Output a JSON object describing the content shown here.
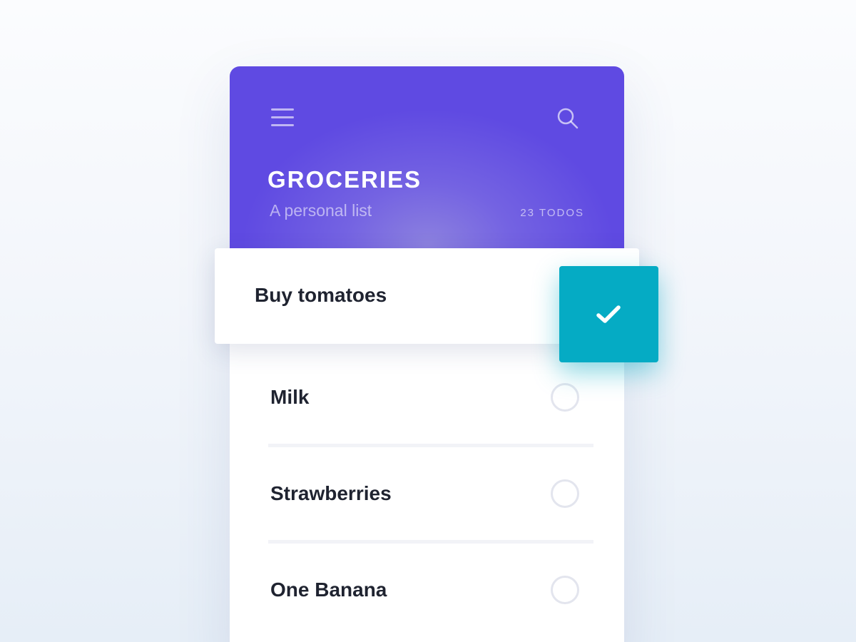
{
  "app": {
    "header": {
      "menu_icon": "hamburger-menu-icon",
      "search_icon": "search-icon",
      "title": "GROCERIES",
      "subtitle": "A personal list",
      "count": "23 TODOS"
    },
    "active_todo": {
      "label": "Buy tomatoes",
      "action_icon": "checkmark-icon",
      "action_color": "#05abc4"
    },
    "todos": [
      {
        "label": "Milk",
        "done": false
      },
      {
        "label": "Strawberries",
        "done": false
      },
      {
        "label": "One Banana",
        "done": false
      }
    ],
    "colors": {
      "header_start": "#5f4ae2",
      "header_glow": "#8c81df",
      "text_dark": "#1f2330",
      "circle_border": "#e3e5ee"
    }
  }
}
